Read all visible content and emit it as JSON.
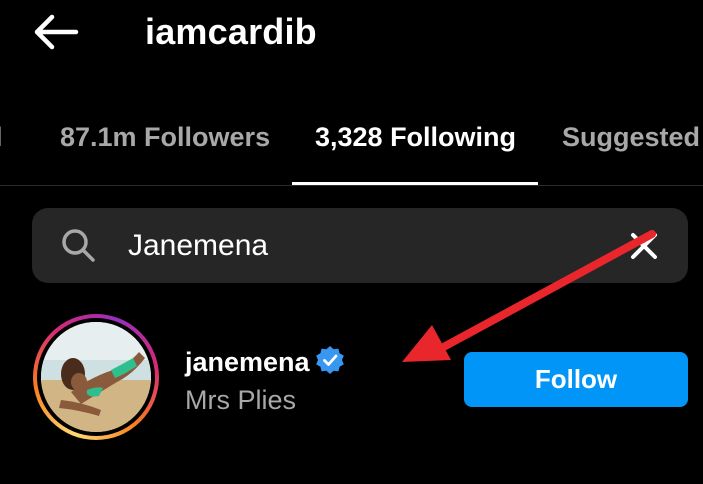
{
  "header": {
    "title": "iamcardib",
    "back_icon": "arrow-left-icon"
  },
  "tabs": [
    {
      "label": "al",
      "active": false
    },
    {
      "label": "87.1m Followers",
      "active": false
    },
    {
      "label": "3,328 Following",
      "active": true
    },
    {
      "label": "Suggested",
      "active": false
    }
  ],
  "search": {
    "value": "Janemena",
    "search_icon": "search-icon",
    "clear_icon": "close-icon"
  },
  "result": {
    "username": "janemena",
    "full_name": "Mrs Plies",
    "verified": true,
    "follow_label": "Follow"
  },
  "colors": {
    "background": "#000000",
    "secondary_text": "#a8a8a8",
    "search_bg": "#262626",
    "follow_button": "#0095f6",
    "verified_badge": "#3897f0",
    "annotation_arrow": "#e8262c"
  }
}
